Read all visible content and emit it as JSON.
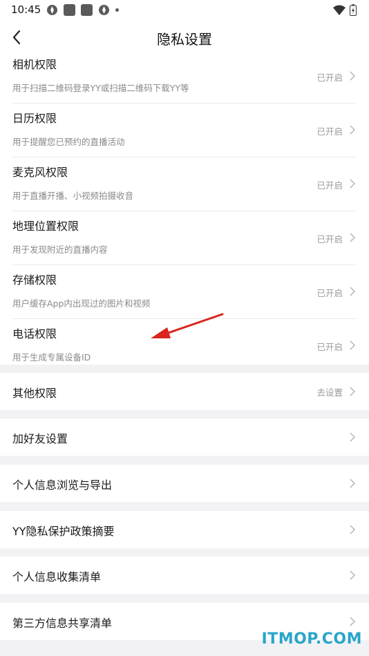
{
  "status_bar": {
    "time": "10:45"
  },
  "header": {
    "title": "隐私设置"
  },
  "permissions": [
    {
      "title": "相机权限",
      "desc": "用于扫描二维码登录YY或扫描二维码下载YY等",
      "status": "已开启"
    },
    {
      "title": "日历权限",
      "desc": "用于提醒您已预约的直播活动",
      "status": "已开启"
    },
    {
      "title": "麦克风权限",
      "desc": "用于直播开播、小视频拍摄收音",
      "status": "已开启"
    },
    {
      "title": "地理位置权限",
      "desc": "用于发现附近的直播内容",
      "status": "已开启"
    },
    {
      "title": "存储权限",
      "desc": "用户缓存App内出现过的图片和视频",
      "status": "已开启"
    },
    {
      "title": "电话权限",
      "desc": "用于生成专属设备ID",
      "status": "已开启"
    }
  ],
  "other_settings": [
    {
      "label": "其他权限",
      "status": "去设置"
    },
    {
      "label": "加好友设置",
      "status": ""
    },
    {
      "label": "个人信息浏览与导出",
      "status": ""
    },
    {
      "label": "YY隐私保护政策摘要",
      "status": ""
    },
    {
      "label": "个人信息收集清单",
      "status": ""
    },
    {
      "label": "第三方信息共享清单",
      "status": ""
    }
  ],
  "watermark": "ITMOP.COM",
  "colors": {
    "separator": "#ebebeb",
    "background": "#f2f2f5",
    "arrow": "#d9251c",
    "watermark": "#2aa4c9"
  }
}
